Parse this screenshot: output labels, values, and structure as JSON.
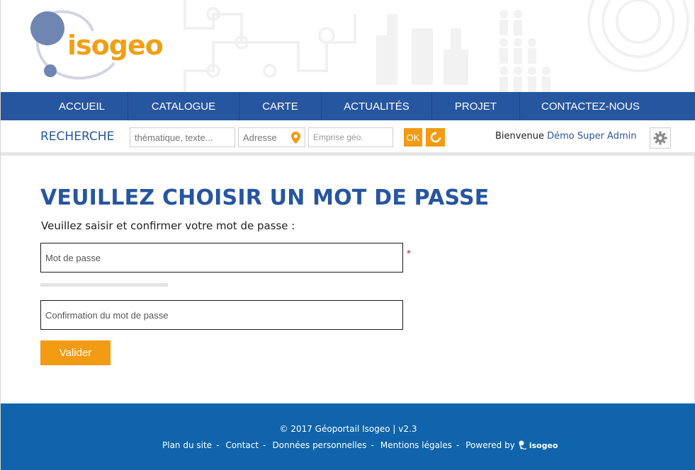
{
  "brand": {
    "logo_text": "isogeo"
  },
  "nav": {
    "items": [
      {
        "label": "ACCUEIL",
        "width": 130
      },
      {
        "label": "CATALOGUE",
        "width": 157
      },
      {
        "label": "CARTE",
        "width": 116
      },
      {
        "label": "ACTUALITÉS",
        "width": 156
      },
      {
        "label": "PROJET",
        "width": 124
      },
      {
        "label": "CONTACTEZ-NOUS",
        "width": 199
      }
    ]
  },
  "search": {
    "label": "RECHERCHE",
    "thematic_placeholder": "thématique, texte...",
    "address_placeholder": "Adresse",
    "extent_placeholder": "Emprise géo.",
    "ok_label": "OK",
    "welcome_text": "Bienvenue",
    "user_name": "Démo Super Admin"
  },
  "main": {
    "title": "VEUILLEZ CHOISIR UN MOT DE PASSE",
    "subtitle": "Veuillez saisir et confirmer votre mot de passe :",
    "password_placeholder": "Mot de passe",
    "confirm_placeholder": "Confirmation du mot de passe",
    "required_mark": "*",
    "password_strength": 0,
    "submit_label": "Valider"
  },
  "footer": {
    "copyright": "© 2017 Géoportail Isogeo | v2.3",
    "links": [
      "Plan du site",
      "Contact",
      "Données personnelles",
      "Mentions légales"
    ],
    "separator": "-",
    "powered_by": "Powered by",
    "powered_logo_text": "isogeo"
  },
  "colors": {
    "nav_bg": "#2756a0",
    "accent_orange": "#f39b12",
    "title_blue": "#2756a0",
    "footer_bg": "#0f64ab",
    "required_red": "#d9262c"
  },
  "icons": [
    "location-pin-icon",
    "reset-icon",
    "gear-icon",
    "isogeo-logo-icon"
  ]
}
